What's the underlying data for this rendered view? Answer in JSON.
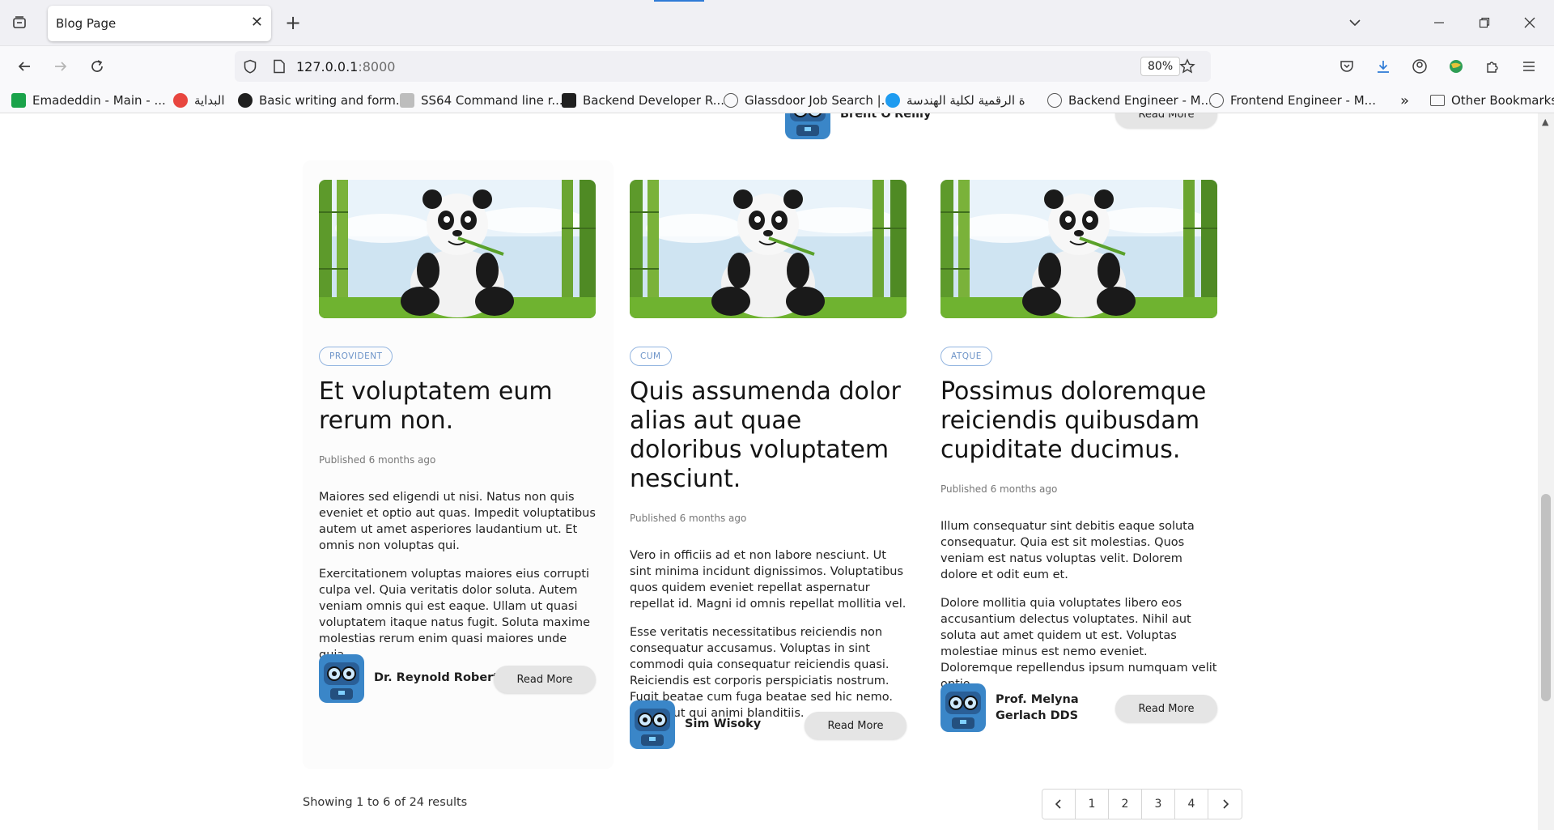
{
  "browser": {
    "tab_title": "Blog Page",
    "url_host": "127.0.0.1",
    "url_port": ":8000",
    "zoom": "80%",
    "bookmarks": [
      {
        "label": "Emadeddin - Main - ...",
        "color": "#1aa34a"
      },
      {
        "label": "البداية",
        "color": "#e8463f"
      },
      {
        "label": "Basic writing and form...",
        "color": "#1f1f1f"
      },
      {
        "label": "SS64 Command line r...",
        "color": "#bdbdbd"
      },
      {
        "label": "Backend Developer R...",
        "color": "#1f1f1f"
      },
      {
        "label": "Glassdoor Job Search |...",
        "color": "#555555"
      },
      {
        "label": "ة الرقمية لكلية الهندسة",
        "color": "#1e9bf0"
      },
      {
        "label": "Backend Engineer - M...",
        "color": "#555555"
      },
      {
        "label": "Frontend Engineer - M...",
        "color": "#555555"
      }
    ],
    "other_bookmarks": "Other Bookmarks"
  },
  "previous_row": {
    "author": "Brent O'Reilly",
    "read_more": "Read More"
  },
  "posts": [
    {
      "tag": "PROVIDENT",
      "title": "Et voluptatem eum rerum non.",
      "published": "Published 6 months ago",
      "paragraphs": [
        "Maiores sed eligendi ut nisi. Natus non quis eveniet et optio aut quas. Impedit voluptatibus autem ut amet asperiores laudantium ut. Et omnis non voluptas qui.",
        "Exercitationem voluptas maiores eius corrupti culpa vel. Quia veritatis dolor soluta. Autem veniam omnis qui est eaque. Ullam ut quasi voluptatem itaque natus fugit. Soluta maxime molestias rerum enim quasi maiores unde quia."
      ],
      "author": "Dr. Reynold Roberts",
      "read_more": "Read More"
    },
    {
      "tag": "CUM",
      "title": "Quis assumenda dolor alias aut quae doloribus voluptatem nesciunt.",
      "published": "Published 6 months ago",
      "paragraphs": [
        "Vero in officiis ad et non labore nesciunt. Ut sint minima incidunt dignissimos. Voluptatibus quos quidem eveniet repellat aspernatur repellat id. Magni id omnis repellat mollitia vel.",
        "Esse veritatis necessitatibus reiciendis non consequatur accusamus. Voluptas in sint commodi quia consequatur reiciendis quasi. Reiciendis est corporis perspiciatis nostrum. Fugit beatae cum fuga beatae sed hic nemo. Id odio ut qui animi blanditiis."
      ],
      "author": "Sim Wisoky",
      "read_more": "Read More"
    },
    {
      "tag": "ATQUE",
      "title": "Possimus doloremque reiciendis quibusdam cupiditate ducimus.",
      "published": "Published 6 months ago",
      "paragraphs": [
        "Illum consequatur sint debitis eaque soluta consequatur. Quia est sit molestias. Quos veniam est natus voluptas velit. Dolorem dolore et odit eum et.",
        "Dolore mollitia quia voluptates libero eos accusantium delectus voluptates. Nihil aut soluta aut amet quidem ut est. Voluptas molestiae minus est nemo eveniet. Doloremque repellendus ipsum numquam velit optio."
      ],
      "author": "Prof. Melyna Gerlach DDS",
      "read_more": "Read More"
    }
  ],
  "pagination": {
    "summary": "Showing 1 to 6 of 24 results",
    "pages": [
      "1",
      "2",
      "3",
      "4"
    ],
    "prev_icon": "chevron-left-icon",
    "next_icon": "chevron-right-icon"
  }
}
